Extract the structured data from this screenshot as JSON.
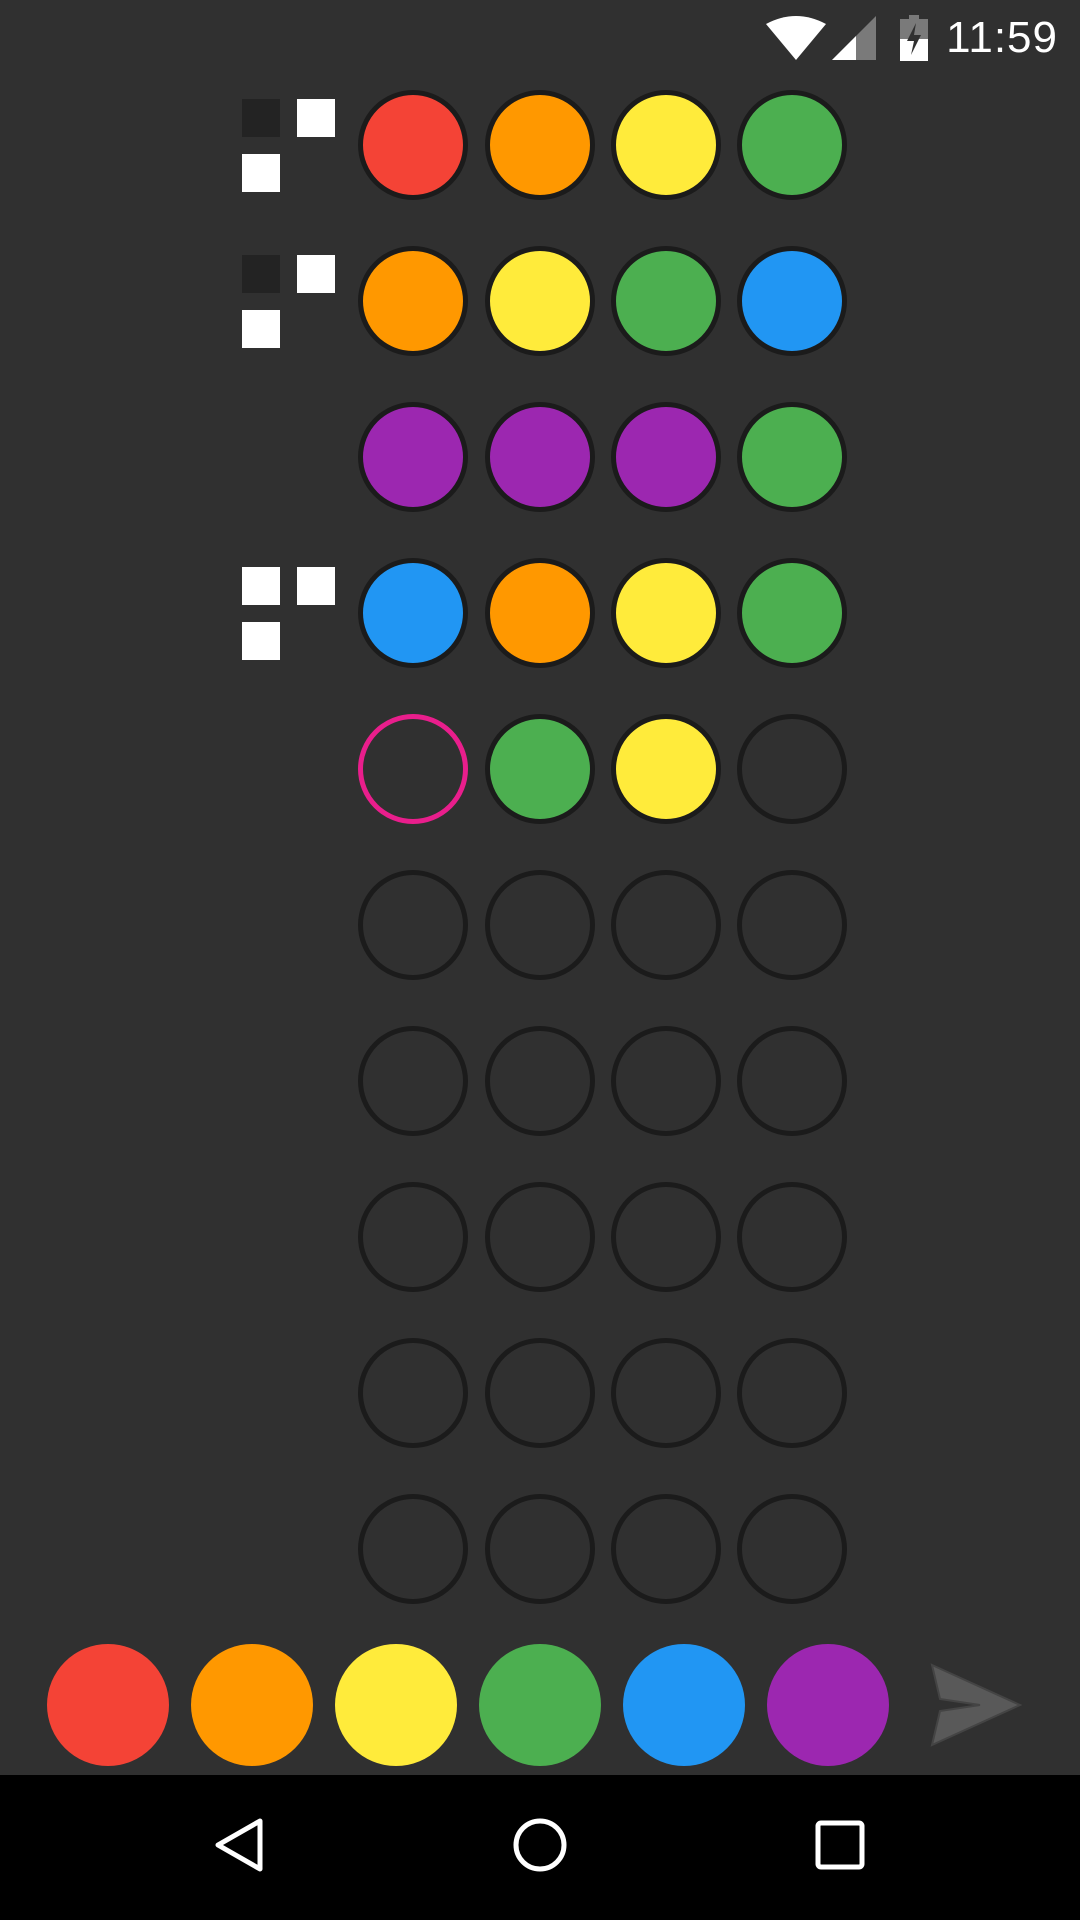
{
  "status_bar": {
    "time": "11:59",
    "icons": [
      "wifi-icon",
      "cell-signal-icon",
      "battery-charging-icon"
    ]
  },
  "colors": {
    "red": "#f44336",
    "orange": "#ff9800",
    "yellow": "#ffeb3b",
    "green": "#4caf50",
    "blue": "#2196f3",
    "purple": "#9c27b0",
    "selection": "#e91e8c",
    "feedback_white": "#ffffff",
    "feedback_dark": "#232323"
  },
  "board": {
    "rows": [
      {
        "pegs": [
          "red",
          "orange",
          "yellow",
          "green"
        ],
        "feedback": [
          "black",
          "white",
          "white",
          "none"
        ]
      },
      {
        "pegs": [
          "orange",
          "yellow",
          "green",
          "blue"
        ],
        "feedback": [
          "black",
          "white",
          "white",
          "none"
        ]
      },
      {
        "pegs": [
          "purple",
          "purple",
          "purple",
          "green"
        ],
        "feedback": [
          "none",
          "none",
          "none",
          "none"
        ]
      },
      {
        "pegs": [
          "blue",
          "orange",
          "yellow",
          "green"
        ],
        "feedback": [
          "white",
          "white",
          "white",
          "none"
        ]
      },
      {
        "pegs": [
          "empty",
          "green",
          "yellow",
          "empty"
        ],
        "feedback": [
          "none",
          "none",
          "none",
          "none"
        ],
        "active": true,
        "selected_slot": 0
      },
      {
        "pegs": [
          "empty",
          "empty",
          "empty",
          "empty"
        ],
        "feedback": [
          "none",
          "none",
          "none",
          "none"
        ]
      },
      {
        "pegs": [
          "empty",
          "empty",
          "empty",
          "empty"
        ],
        "feedback": [
          "none",
          "none",
          "none",
          "none"
        ]
      },
      {
        "pegs": [
          "empty",
          "empty",
          "empty",
          "empty"
        ],
        "feedback": [
          "none",
          "none",
          "none",
          "none"
        ]
      },
      {
        "pegs": [
          "empty",
          "empty",
          "empty",
          "empty"
        ],
        "feedback": [
          "none",
          "none",
          "none",
          "none"
        ]
      },
      {
        "pegs": [
          "empty",
          "empty",
          "empty",
          "empty"
        ],
        "feedback": [
          "none",
          "none",
          "none",
          "none"
        ]
      }
    ]
  },
  "palette": {
    "options": [
      "red",
      "orange",
      "yellow",
      "green",
      "blue",
      "purple"
    ],
    "submit_icon": "send-icon"
  },
  "nav_bar": {
    "buttons": [
      "back-icon",
      "home-icon",
      "recents-icon"
    ]
  }
}
